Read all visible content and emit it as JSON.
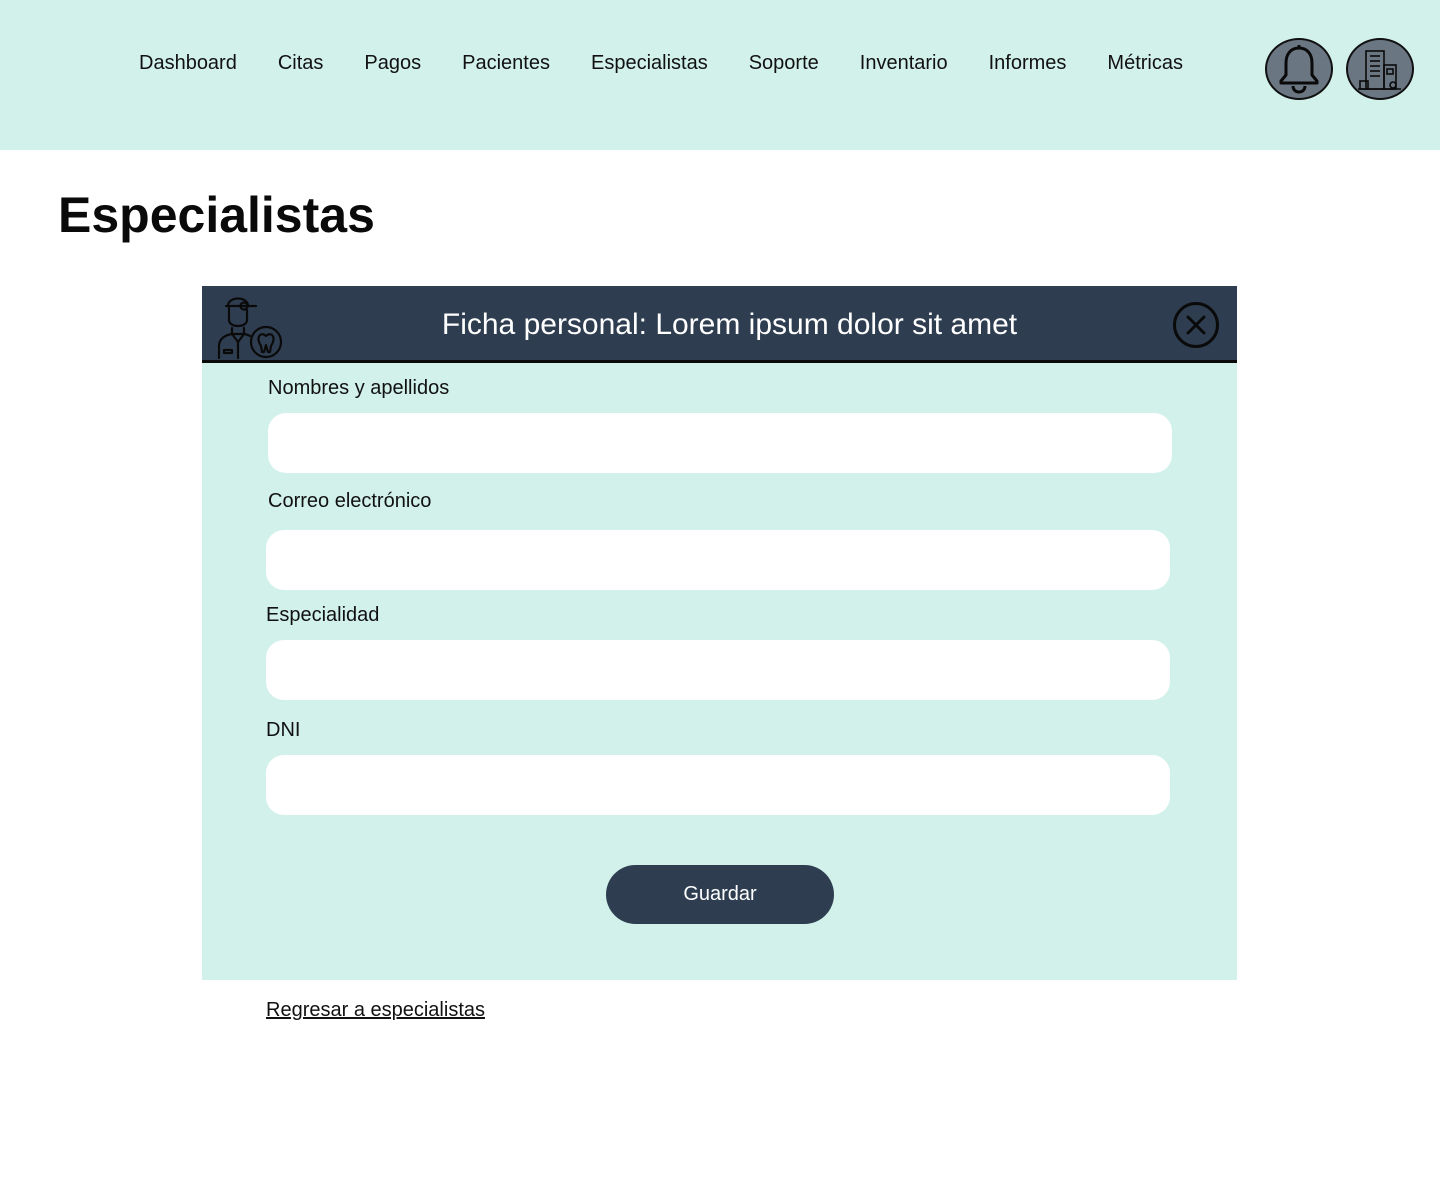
{
  "nav": {
    "items": [
      "Dashboard",
      "Citas",
      "Pagos",
      "Pacientes",
      "Especialistas",
      "Soporte",
      "Inventario",
      "Informes",
      "Métricas"
    ]
  },
  "header_icons": {
    "notifications": "bell-icon",
    "organization": "building-icon"
  },
  "page": {
    "title": "Especialistas"
  },
  "modal": {
    "title": "Ficha personal: Lorem ipsum dolor sit amet",
    "header_icon": "doctor-icon",
    "close_icon": "close-icon",
    "fields": [
      {
        "label": "Nombres y apellidos",
        "value": ""
      },
      {
        "label": "Correo electrónico",
        "value": ""
      },
      {
        "label": "Especialidad",
        "value": ""
      },
      {
        "label": "DNI",
        "value": ""
      }
    ],
    "save_label": "Guardar"
  },
  "back_link": "Regresar a especialistas",
  "colors": {
    "mint": "#d2f1ea",
    "navy": "#2e3e50",
    "icon_gray": "#6b7683"
  }
}
